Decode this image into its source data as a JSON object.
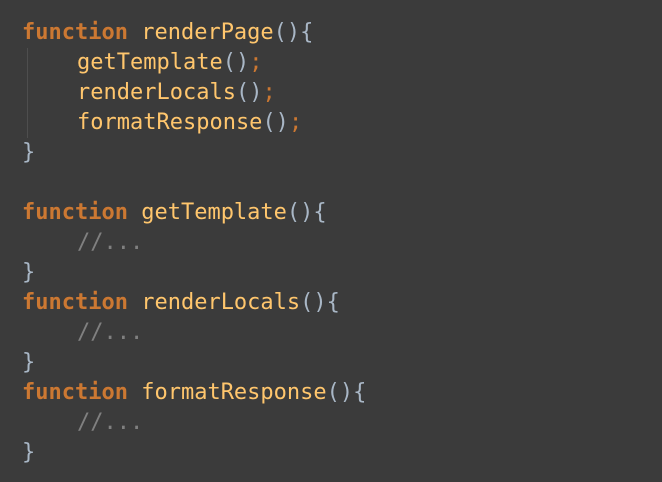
{
  "colors": {
    "background": "#3b3b3b",
    "keyword": "#cc7832",
    "function_name": "#ffc66d",
    "default_text": "#a9b7c6",
    "comment": "#808080"
  },
  "code": {
    "line1": {
      "keyword": "function",
      "name": "renderPage",
      "parens": "()",
      "brace": "{"
    },
    "line2": {
      "name": "getTemplate",
      "parens": "()",
      "semi": ";"
    },
    "line3": {
      "name": "renderLocals",
      "parens": "()",
      "semi": ";"
    },
    "line4": {
      "name": "formatResponse",
      "parens": "()",
      "semi": ";"
    },
    "line5": {
      "brace": "}"
    },
    "line7": {
      "keyword": "function",
      "name": "getTemplate",
      "parens": "()",
      "brace": "{"
    },
    "line8": {
      "comment": "//..."
    },
    "line9": {
      "brace": "}"
    },
    "line10": {
      "keyword": "function",
      "name": "renderLocals",
      "parens": "()",
      "brace": "{"
    },
    "line11": {
      "comment": "//..."
    },
    "line12": {
      "brace": "}"
    },
    "line13": {
      "keyword": "function",
      "name": "formatResponse",
      "parens": "()",
      "brace": "{"
    },
    "line14": {
      "comment": "//..."
    },
    "line15": {
      "brace": "}"
    }
  }
}
